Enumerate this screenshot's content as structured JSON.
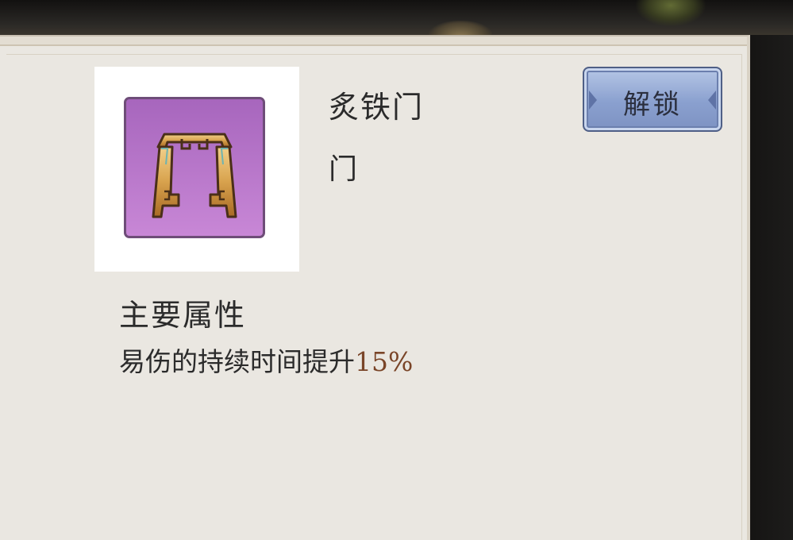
{
  "item": {
    "name": "炙铁门",
    "type": "门",
    "icon": "gate-icon",
    "rarity_color": "#b070c8"
  },
  "attributes": {
    "title": "主要属性",
    "description_prefix": "易伤的持续时间提升",
    "value": "15%",
    "value_color": "#7a4528"
  },
  "unlock_button": {
    "label": "解锁"
  }
}
